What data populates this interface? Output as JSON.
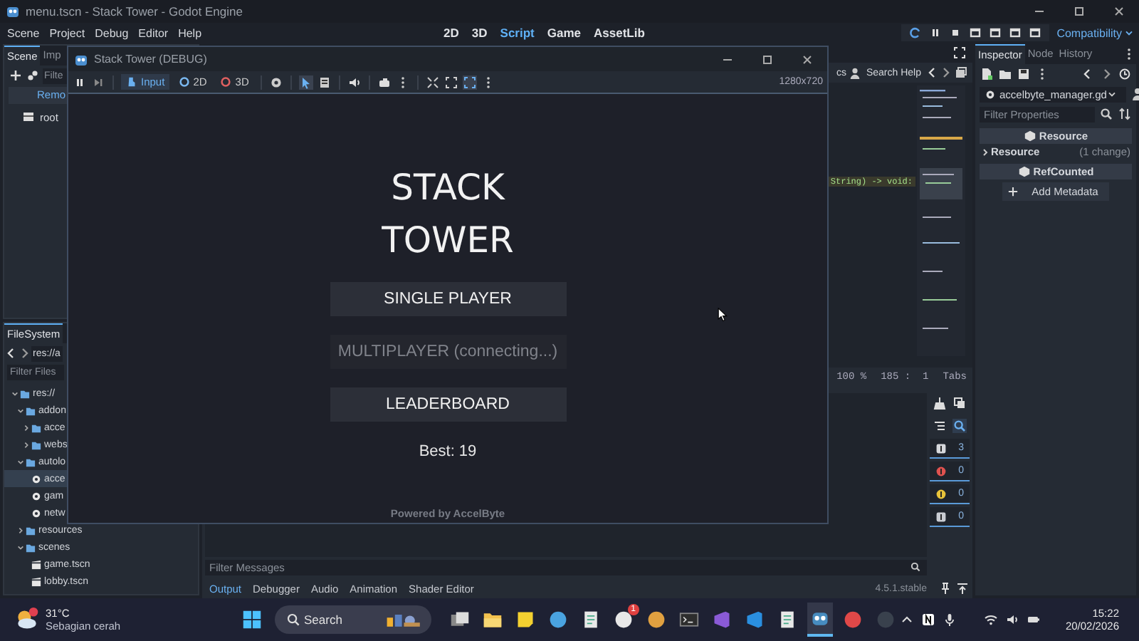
{
  "window": {
    "title": "menu.tscn - Stack Tower - Godot Engine"
  },
  "menu": [
    "Scene",
    "Project",
    "Debug",
    "Editor",
    "Help"
  ],
  "main_screens": [
    {
      "label": "2D",
      "selected": false
    },
    {
      "label": "3D",
      "selected": false
    },
    {
      "label": "Script",
      "selected": true
    },
    {
      "label": "Game",
      "selected": false
    },
    {
      "label": "AssetLib",
      "selected": false
    }
  ],
  "renderer": "Compatibility",
  "scene_dock": {
    "tabs": [
      {
        "label": "Scene",
        "selected": true
      },
      {
        "label": "Imp",
        "selected": false
      }
    ],
    "search": {
      "placeholder": "Filte"
    },
    "remote_button": "Remo",
    "tree": [
      {
        "label": "root"
      }
    ]
  },
  "filesystem": {
    "tab": "FileSystem",
    "path": "res://a",
    "filter": {
      "placeholder": "Filter Files"
    },
    "tree": [
      {
        "label": "res://",
        "kind": "folder",
        "expanded": true,
        "selected": false,
        "children": [
          {
            "label": "addon",
            "kind": "folder",
            "expanded": true,
            "selected": false,
            "children": [
              {
                "label": "acce",
                "kind": "folder",
                "expanded": false,
                "selected": false
              },
              {
                "label": "webs",
                "kind": "folder",
                "expanded": false,
                "selected": false
              }
            ]
          },
          {
            "label": "autolo",
            "kind": "folder",
            "expanded": true,
            "selected": false,
            "children": [
              {
                "label": "acce",
                "kind": "script",
                "selected": true
              },
              {
                "label": "gam",
                "kind": "script",
                "selected": false
              },
              {
                "label": "netw",
                "kind": "script",
                "selected": false
              }
            ]
          },
          {
            "label": "resources",
            "kind": "folder",
            "expanded": false,
            "selected": false
          },
          {
            "label": "scenes",
            "kind": "folder",
            "expanded": true,
            "selected": false,
            "children": [
              {
                "label": "game.tscn",
                "kind": "scene",
                "selected": false
              },
              {
                "label": "lobby.tscn",
                "kind": "scene",
                "selected": false
              }
            ]
          }
        ]
      }
    ]
  },
  "script_editor": {
    "docs": "cs",
    "search_help": "Search Help",
    "code_line": "String) -> void:",
    "status": {
      "zoom": "100 %",
      "position": "185 :  1",
      "indent": "Tabs"
    }
  },
  "output": {
    "filter": {
      "placeholder": "Filter Messages"
    },
    "tabs": [
      {
        "label": "Output",
        "selected": true
      },
      {
        "label": "Debugger",
        "selected": false
      },
      {
        "label": "Audio",
        "selected": false
      },
      {
        "label": "Animation",
        "selected": false
      },
      {
        "label": "Shader Editor",
        "selected": false
      }
    ],
    "version": "4.5.1.stable",
    "filters": [
      {
        "kind": "message",
        "count": "3"
      },
      {
        "kind": "error",
        "count": "0"
      },
      {
        "kind": "warning",
        "count": "0"
      },
      {
        "kind": "verbose",
        "count": "0"
      }
    ]
  },
  "inspector": {
    "tabs": [
      {
        "label": "Inspector",
        "selected": true
      },
      {
        "label": "Node",
        "selected": false
      },
      {
        "label": "History",
        "selected": false
      }
    ],
    "script": "accelbyte_manager.gd",
    "filter": {
      "placeholder": "Filter Properties"
    },
    "sections": [
      {
        "kind": "header",
        "label": "Resource"
      },
      {
        "kind": "property",
        "label": "Resource",
        "value": "(1 change)"
      },
      {
        "kind": "header",
        "label": "RefCounted"
      }
    ],
    "add_metadata": "Add Metadata"
  },
  "game_window": {
    "title": "Stack Tower (DEBUG)",
    "toolbar": [
      {
        "label": "Input",
        "kind": "input",
        "selected": true
      },
      {
        "label": "2D",
        "kind": "canvas",
        "selected": false
      },
      {
        "label": "3D",
        "kind": "spatial",
        "selected": false
      }
    ],
    "resolution": "1280x720",
    "heading": [
      "STACK",
      "TOWER"
    ],
    "buttons": [
      {
        "label": "SINGLE PLAYER",
        "disabled": false
      },
      {
        "label": "MULTIPLAYER (connecting...)",
        "disabled": true
      },
      {
        "label": "LEADERBOARD",
        "disabled": false
      }
    ],
    "best": "Best: 19",
    "footer": "Powered by AccelByte"
  },
  "taskbar": {
    "weather": {
      "temperature": "31°C",
      "condition": "Sebagian cerah"
    },
    "search": {
      "placeholder": "Search"
    },
    "badge": "1",
    "time": "15:22",
    "date": "20/02/2026"
  }
}
